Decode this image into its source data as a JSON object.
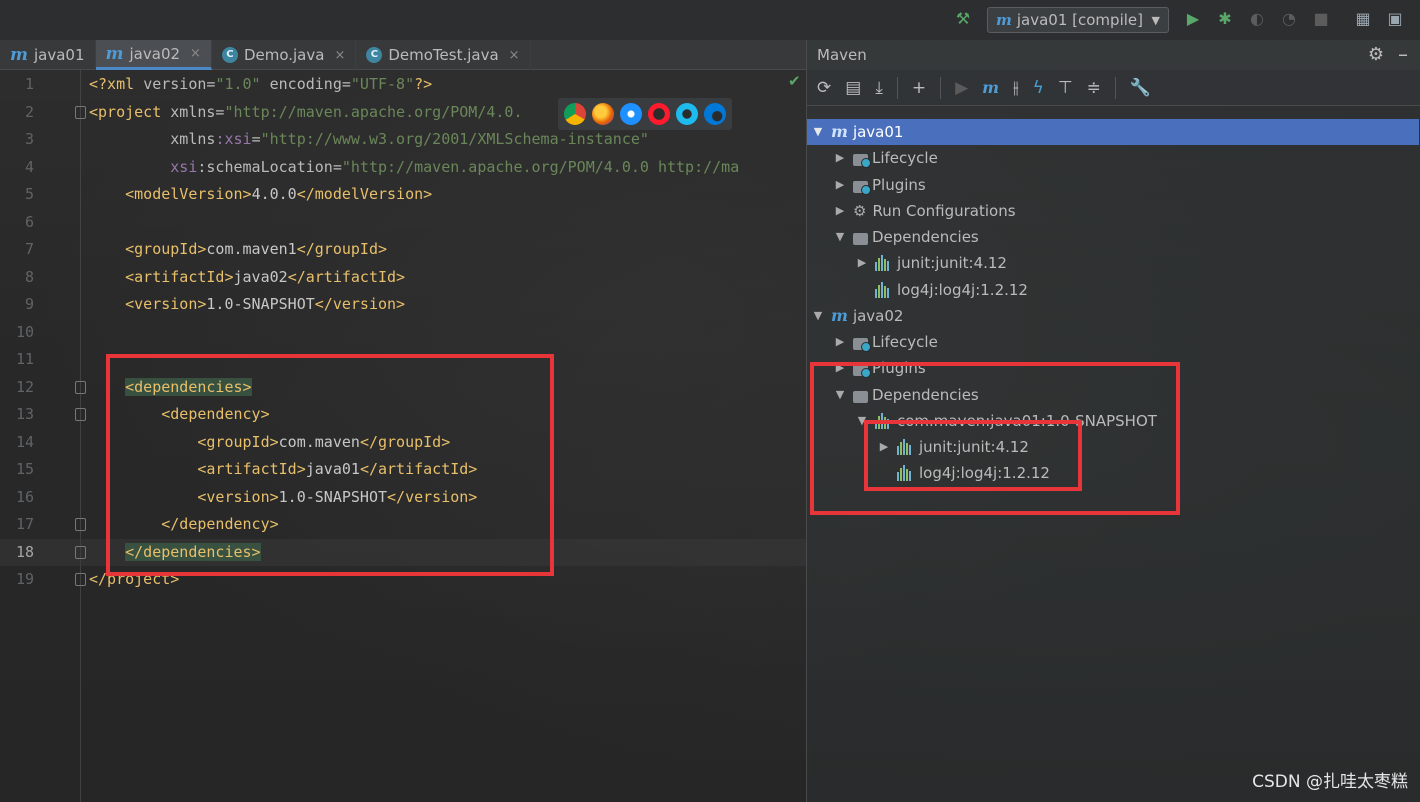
{
  "toolbar": {
    "run_config": "java01 [compile]"
  },
  "tabs": [
    {
      "label": "java01",
      "icon": "maven-icon",
      "active": false,
      "closable": false
    },
    {
      "label": "java02",
      "icon": "maven-icon",
      "active": true,
      "closable": true
    },
    {
      "label": "Demo.java",
      "icon": "class-icon",
      "active": false,
      "closable": true
    },
    {
      "label": "DemoTest.java",
      "icon": "class-icon",
      "active": false,
      "closable": true
    }
  ],
  "editor": {
    "lines": [
      {
        "n": "1",
        "parts": [
          [
            "pi",
            "<?xml "
          ],
          [
            "attr",
            "version="
          ],
          [
            "str",
            "\"1.0\""
          ],
          [
            "attr",
            " encoding="
          ],
          [
            "str",
            "\"UTF-8\""
          ],
          [
            "pi",
            "?>"
          ]
        ]
      },
      {
        "n": "2",
        "parts": [
          [
            "tag",
            "<project "
          ],
          [
            "attr",
            "xmlns="
          ],
          [
            "str",
            "\"http://maven.apache.org/POM/4.0."
          ]
        ]
      },
      {
        "n": "3",
        "parts": [
          [
            "txt",
            "         "
          ],
          [
            "attr",
            "xmlns"
          ],
          [
            "ns",
            ":xsi"
          ],
          [
            "attr",
            "="
          ],
          [
            "str",
            "\"http://www.w3.org/2001/XMLSchema-instance\""
          ]
        ]
      },
      {
        "n": "4",
        "parts": [
          [
            "txt",
            "         "
          ],
          [
            "ns",
            "xsi"
          ],
          [
            "attr",
            ":schemaLocation="
          ],
          [
            "str",
            "\"http://maven.apache.org/POM/4.0.0 http://ma"
          ]
        ]
      },
      {
        "n": "5",
        "parts": [
          [
            "txt",
            "    "
          ],
          [
            "tag",
            "<modelVersion>"
          ],
          [
            "txt",
            "4.0.0"
          ],
          [
            "tag",
            "</modelVersion>"
          ]
        ]
      },
      {
        "n": "6",
        "parts": []
      },
      {
        "n": "7",
        "parts": [
          [
            "txt",
            "    "
          ],
          [
            "tag",
            "<groupId>"
          ],
          [
            "txt",
            "com.maven1"
          ],
          [
            "tag",
            "</groupId>"
          ]
        ]
      },
      {
        "n": "8",
        "parts": [
          [
            "txt",
            "    "
          ],
          [
            "tag",
            "<artifactId>"
          ],
          [
            "txt",
            "java02"
          ],
          [
            "tag",
            "</artifactId>"
          ]
        ]
      },
      {
        "n": "9",
        "parts": [
          [
            "txt",
            "    "
          ],
          [
            "tag",
            "<version>"
          ],
          [
            "txt",
            "1.0-SNAPSHOT"
          ],
          [
            "tag",
            "</version>"
          ]
        ]
      },
      {
        "n": "10",
        "parts": []
      },
      {
        "n": "11",
        "parts": []
      },
      {
        "n": "12",
        "parts": [
          [
            "txt",
            "    "
          ],
          [
            "taghl",
            "<dependencies>"
          ]
        ]
      },
      {
        "n": "13",
        "parts": [
          [
            "txt",
            "        "
          ],
          [
            "tag",
            "<dependency>"
          ]
        ]
      },
      {
        "n": "14",
        "parts": [
          [
            "txt",
            "            "
          ],
          [
            "tag",
            "<groupId>"
          ],
          [
            "txt",
            "com.maven"
          ],
          [
            "tag",
            "</groupId>"
          ]
        ]
      },
      {
        "n": "15",
        "parts": [
          [
            "txt",
            "            "
          ],
          [
            "tag",
            "<artifactId>"
          ],
          [
            "txt",
            "java01"
          ],
          [
            "tag",
            "</artifactId>"
          ]
        ]
      },
      {
        "n": "16",
        "parts": [
          [
            "txt",
            "            "
          ],
          [
            "tag",
            "<version>"
          ],
          [
            "txt",
            "1.0-SNAPSHOT"
          ],
          [
            "tag",
            "</version>"
          ]
        ]
      },
      {
        "n": "17",
        "parts": [
          [
            "txt",
            "        "
          ],
          [
            "tag",
            "</dependency>"
          ]
        ]
      },
      {
        "n": "18",
        "parts": [
          [
            "txt",
            "    "
          ],
          [
            "taghl",
            "</dependencies>"
          ]
        ],
        "current": true
      },
      {
        "n": "19",
        "parts": [
          [
            "tag",
            "</project>"
          ]
        ]
      }
    ]
  },
  "maven": {
    "title": "Maven",
    "tree": [
      {
        "label": "java01",
        "depth": 0,
        "arrow": "down",
        "icon": "maven",
        "selected": true
      },
      {
        "label": "Lifecycle",
        "depth": 1,
        "arrow": "right",
        "icon": "folder"
      },
      {
        "label": "Plugins",
        "depth": 1,
        "arrow": "right",
        "icon": "folder"
      },
      {
        "label": "Run Configurations",
        "depth": 1,
        "arrow": "right",
        "icon": "gear"
      },
      {
        "label": "Dependencies",
        "depth": 1,
        "arrow": "down",
        "icon": "lib-folder"
      },
      {
        "label": "junit:junit:4.12",
        "depth": 2,
        "arrow": "right",
        "icon": "lib"
      },
      {
        "label": "log4j:log4j:1.2.12",
        "depth": 2,
        "arrow": "",
        "icon": "lib"
      },
      {
        "label": "java02",
        "depth": 0,
        "arrow": "down",
        "icon": "maven"
      },
      {
        "label": "Lifecycle",
        "depth": 1,
        "arrow": "right",
        "icon": "folder"
      },
      {
        "label": "Plugins",
        "depth": 1,
        "arrow": "right",
        "icon": "folder"
      },
      {
        "label": "Dependencies",
        "depth": 1,
        "arrow": "down",
        "icon": "lib-folder"
      },
      {
        "label": "com.maven:java01:1.0-SNAPSHOT",
        "depth": 2,
        "arrow": "down",
        "icon": "lib"
      },
      {
        "label": "junit:junit:4.12",
        "depth": 3,
        "arrow": "right",
        "icon": "lib"
      },
      {
        "label": "log4j:log4j:1.2.12",
        "depth": 3,
        "arrow": "",
        "icon": "lib"
      }
    ]
  },
  "watermark": "CSDN @扎哇太枣糕",
  "colors": {
    "highlight_box": "#e8353a",
    "selection": "#4a6fbd",
    "xml_tag": "#e8bf6a",
    "xml_string": "#6a8759"
  }
}
